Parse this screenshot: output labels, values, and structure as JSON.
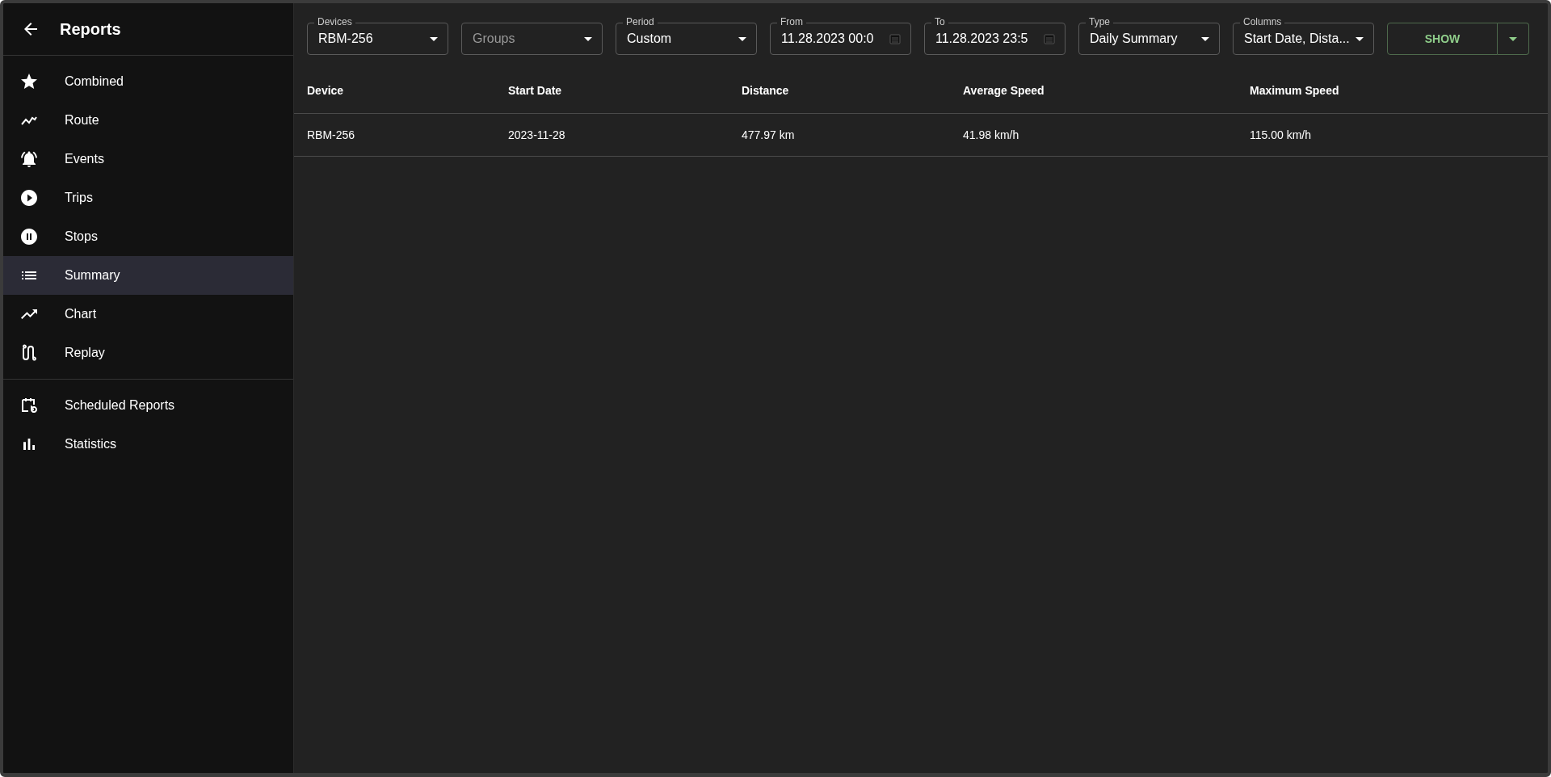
{
  "sidebar": {
    "title": "Reports",
    "groups": [
      [
        {
          "label": "Combined",
          "selected": false
        },
        {
          "label": "Route",
          "selected": false
        },
        {
          "label": "Events",
          "selected": false
        },
        {
          "label": "Trips",
          "selected": false
        },
        {
          "label": "Stops",
          "selected": false
        },
        {
          "label": "Summary",
          "selected": true
        },
        {
          "label": "Chart",
          "selected": false
        },
        {
          "label": "Replay",
          "selected": false
        }
      ],
      [
        {
          "label": "Scheduled Reports",
          "selected": false
        },
        {
          "label": "Statistics",
          "selected": false
        }
      ]
    ]
  },
  "filters": [
    {
      "kind": "select",
      "label": "Devices",
      "value": "RBM-256"
    },
    {
      "kind": "select",
      "placeholder": "Groups"
    },
    {
      "kind": "select",
      "label": "Period",
      "value": "Custom"
    },
    {
      "kind": "date",
      "label": "From",
      "value": "11.28.2023 00:0"
    },
    {
      "kind": "date",
      "label": "To",
      "value": "11.28.2023 23:5"
    },
    {
      "kind": "select",
      "label": "Type",
      "value": "Daily Summary"
    },
    {
      "kind": "select",
      "label": "Columns",
      "value": "Start Date, Dista..."
    }
  ],
  "show_button": "SHOW",
  "table": {
    "columns": [
      "Device",
      "Start Date",
      "Distance",
      "Average Speed",
      "Maximum Speed"
    ],
    "rows": [
      [
        "RBM-256",
        "2023-11-28",
        "477.97 km",
        "41.98 km/h",
        "115.00 km/h"
      ]
    ]
  }
}
